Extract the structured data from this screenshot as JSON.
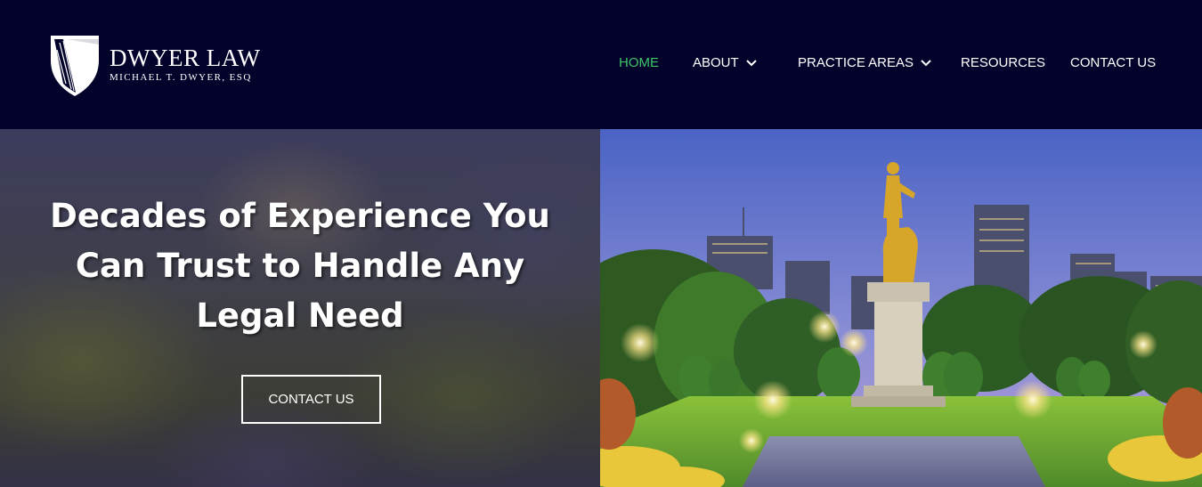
{
  "brand": {
    "name": "DWYER LAW",
    "tagline": "MICHAEL T. DWYER, ESQ",
    "logo_icon": "shield-logo-icon"
  },
  "nav": {
    "items": [
      {
        "label": "HOME",
        "active": true,
        "has_dropdown": false
      },
      {
        "label": "ABOUT",
        "active": false,
        "has_dropdown": true
      },
      {
        "label": "PRACTICE AREAS",
        "active": false,
        "has_dropdown": true
      },
      {
        "label": "RESOURCES",
        "active": false,
        "has_dropdown": false
      },
      {
        "label": "CONTACT US",
        "active": false,
        "has_dropdown": false
      }
    ]
  },
  "hero": {
    "title_lines": [
      "Decades of Experience You",
      "Can Trust to Handle Any",
      "Legal Need"
    ],
    "cta_label": "CONTACT US"
  },
  "colors": {
    "header_bg": "#02022b",
    "active_nav": "#3fc469",
    "text": "#ffffff"
  }
}
